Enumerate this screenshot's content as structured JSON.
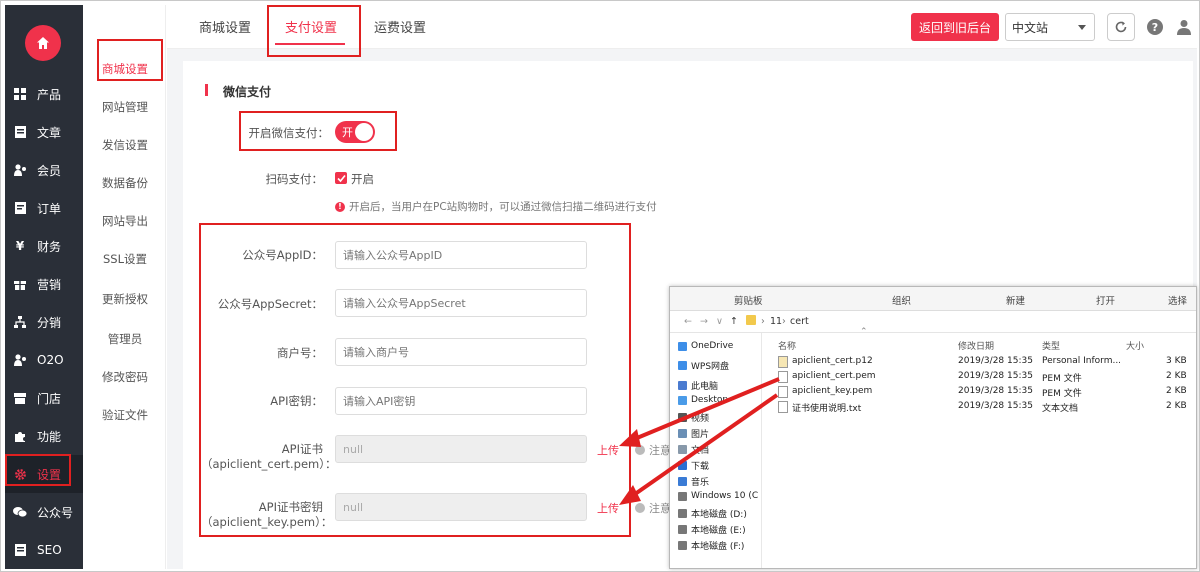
{
  "sidebar": {
    "items": [
      {
        "label": "产品",
        "icon": "grid-icon"
      },
      {
        "label": "文章",
        "icon": "document-icon"
      },
      {
        "label": "会员",
        "icon": "users-icon"
      },
      {
        "label": "订单",
        "icon": "order-icon"
      },
      {
        "label": "财务",
        "icon": "yen-icon"
      },
      {
        "label": "营销",
        "icon": "gift-icon"
      },
      {
        "label": "分销",
        "icon": "sitemap-icon"
      },
      {
        "label": "O2O",
        "icon": "users-icon"
      },
      {
        "label": "门店",
        "icon": "store-icon"
      },
      {
        "label": "功能",
        "icon": "puzzle-icon"
      },
      {
        "label": "设置",
        "icon": "gear-icon"
      },
      {
        "label": "公众号",
        "icon": "wechat-icon"
      },
      {
        "label": "SEO",
        "icon": "seo-icon"
      }
    ]
  },
  "subnav": {
    "items": [
      "商城设置",
      "网站管理",
      "发信设置",
      "数据备份",
      "网站导出",
      "SSL设置",
      "更新授权",
      "管理员",
      "修改密码",
      "验证文件"
    ]
  },
  "tabs": [
    "商城设置",
    "支付设置",
    "运费设置"
  ],
  "header": {
    "back_label": "返回到旧后台",
    "language": "中文站"
  },
  "form": {
    "section_title": "微信支付",
    "enable_label": "开启微信支付：",
    "toggle_text": "开",
    "scan_label": "扫码支付：",
    "scan_option": "开启",
    "hint": "开启后，当用户在PC站购物时，可以通过微信扫描二维码进行支付",
    "appid_label": "公众号AppID：",
    "appid_placeholder": "请输入公众号AppID",
    "appsecret_label": "公众号AppSecret：",
    "appsecret_placeholder": "请输入公众号AppSecret",
    "merchant_label": "商户号：",
    "merchant_placeholder": "请输入商户号",
    "apikey_label": "API密钥：",
    "apikey_placeholder": "请输入API密钥",
    "cert_label_1": "API证书",
    "cert_label_2": "（apiclient_cert.pem）：",
    "cert_value": "null",
    "key_label_1": "API证书密钥",
    "key_label_2": "（apiclient_key.pem）：",
    "key_value": "null",
    "upload": "上传",
    "note": "注意"
  },
  "explorer": {
    "ribbon": [
      "剪贴板",
      "组织",
      "新建",
      "打开",
      "选择"
    ],
    "path": [
      "11",
      "cert"
    ],
    "nav": [
      "OneDrive",
      "WPS网盘",
      "此电脑",
      "Desktop",
      "视频",
      "图片",
      "文档",
      "下载",
      "音乐",
      "Windows 10 (C",
      "本地磁盘 (D:)",
      "本地磁盘 (E:)",
      "本地磁盘 (F:)"
    ],
    "columns": [
      "名称",
      "修改日期",
      "类型",
      "大小"
    ],
    "files": [
      {
        "name": "apiclient_cert.p12",
        "date": "2019/3/28 15:35",
        "type": "Personal Inform...",
        "size": "3 KB"
      },
      {
        "name": "apiclient_cert.pem",
        "date": "2019/3/28 15:35",
        "type": "PEM 文件",
        "size": "2 KB"
      },
      {
        "name": "apiclient_key.pem",
        "date": "2019/3/28 15:35",
        "type": "PEM 文件",
        "size": "2 KB"
      },
      {
        "name": "证书使用说明.txt",
        "date": "2019/3/28 15:35",
        "type": "文本文档",
        "size": "2 KB"
      }
    ]
  },
  "colors": {
    "accent": "#f0324b",
    "sidebar": "#2a2f38",
    "annotation": "#e02020"
  }
}
